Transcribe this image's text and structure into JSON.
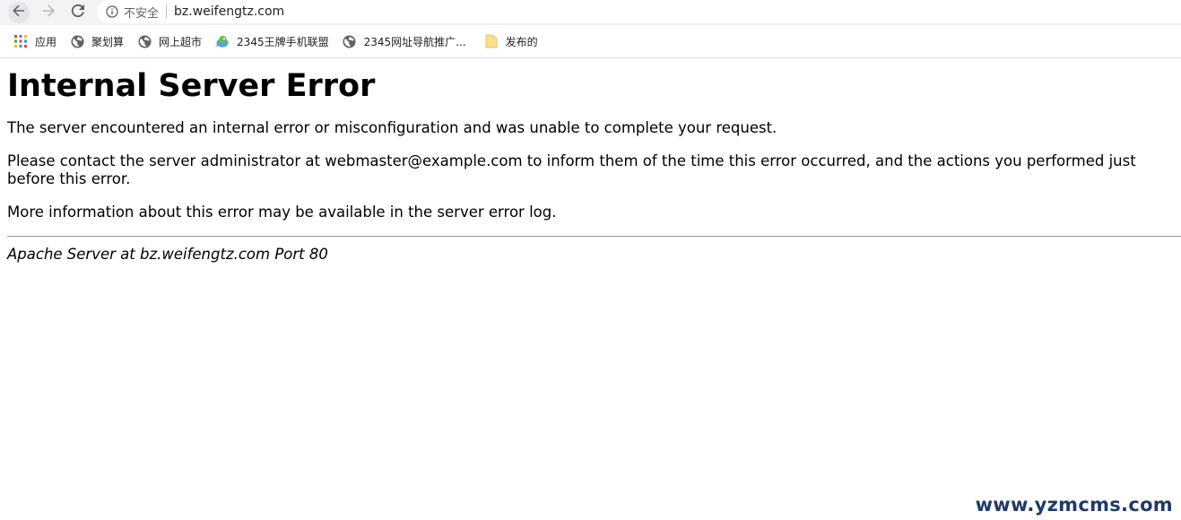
{
  "browser": {
    "security_label": "不安全",
    "url": "bz.weifengtz.com"
  },
  "bookmarks": [
    {
      "label": "应用",
      "icon": "apps-grid-icon"
    },
    {
      "label": "聚划算",
      "icon": "globe-icon"
    },
    {
      "label": "网上超市",
      "icon": "globe-icon"
    },
    {
      "label": "2345王牌手机联盟",
      "icon": "bird-icon"
    },
    {
      "label": "2345网址导航推广...",
      "icon": "globe-icon"
    },
    {
      "label": "发布的",
      "icon": "folder-icon"
    }
  ],
  "page": {
    "heading": "Internal Server Error",
    "paragraph1": "The server encountered an internal error or misconfiguration and was unable to complete your request.",
    "paragraph2": "Please contact the server administrator at webmaster@example.com to inform them of the time this error occurred, and the actions you performed just before this error.",
    "paragraph3": "More information about this error may be available in the server error log.",
    "signature": "Apache Server at bz.weifengtz.com Port 80"
  },
  "watermark": "www.yzmcms.com",
  "colors": {
    "toolbar_bg": "#f1f3f4",
    "watermark": "#1f3a66"
  }
}
